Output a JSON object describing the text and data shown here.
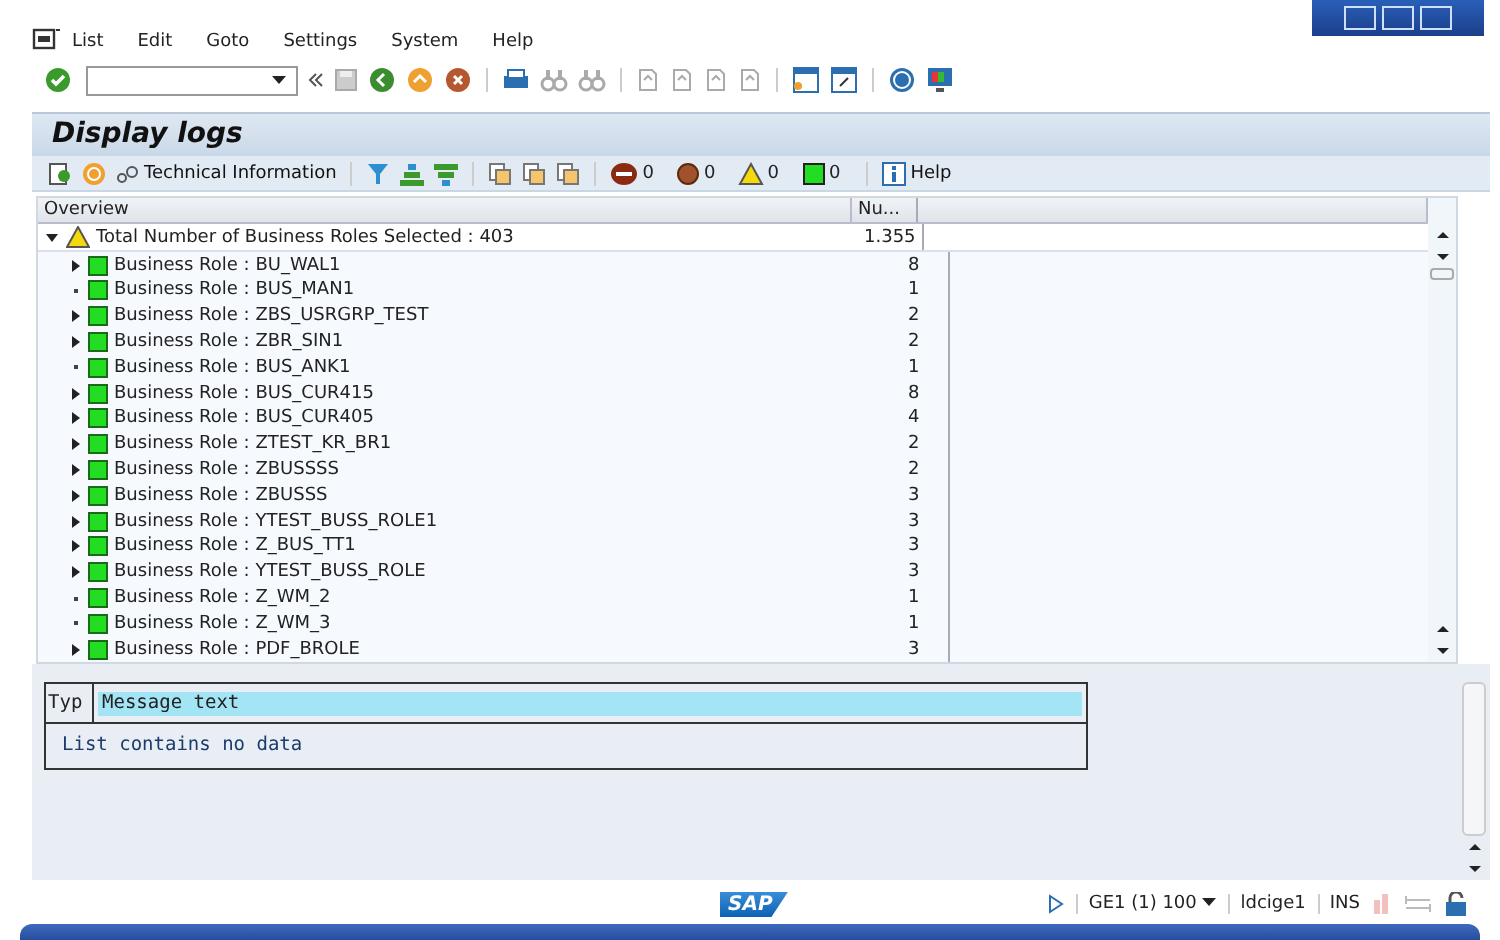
{
  "menu": [
    {
      "label": "List"
    },
    {
      "label": "Edit"
    },
    {
      "label": "Goto"
    },
    {
      "label": "Settings"
    },
    {
      "label": "System"
    },
    {
      "label": "Help"
    }
  ],
  "title": "Display logs",
  "app_toolbar": {
    "technical_info": "Technical Information",
    "counters": [
      {
        "kind": "stop",
        "count": "0"
      },
      {
        "kind": "error",
        "count": "0"
      },
      {
        "kind": "warning",
        "count": "0"
      },
      {
        "kind": "success",
        "count": "0"
      }
    ],
    "help": "Help"
  },
  "tree": {
    "columns": [
      "Overview",
      "Nu..."
    ],
    "root": {
      "label": "Total Number of Business Roles Selected : 403",
      "count": "1.355",
      "expanded": true,
      "children": [
        {
          "kind": "branch",
          "label": "Business Role : BU_WAL1",
          "count": "8"
        },
        {
          "kind": "leaf",
          "label": "Business Role : BUS_MAN1",
          "count": "1"
        },
        {
          "kind": "branch",
          "label": "Business Role : ZBS_USRGRP_TEST",
          "count": "2"
        },
        {
          "kind": "branch",
          "label": "Business Role : ZBR_SIN1",
          "count": "2"
        },
        {
          "kind": "leaf",
          "label": "Business Role : BUS_ANK1",
          "count": "1"
        },
        {
          "kind": "branch",
          "label": "Business Role : BUS_CUR415",
          "count": "8"
        },
        {
          "kind": "branch",
          "label": "Business Role : BUS_CUR405",
          "count": "4"
        },
        {
          "kind": "branch",
          "label": "Business Role : ZTEST_KR_BR1",
          "count": "2"
        },
        {
          "kind": "branch",
          "label": "Business Role : ZBUSSSS",
          "count": "2"
        },
        {
          "kind": "branch",
          "label": "Business Role : ZBUSSS",
          "count": "3"
        },
        {
          "kind": "branch",
          "label": "Business Role : YTEST_BUSS_ROLE1",
          "count": "3"
        },
        {
          "kind": "branch",
          "label": "Business Role : Z_BUS_TT1",
          "count": "3"
        },
        {
          "kind": "branch",
          "label": "Business Role : YTEST_BUSS_ROLE",
          "count": "3"
        },
        {
          "kind": "leaf",
          "label": "Business Role : Z_WM_2",
          "count": "1"
        },
        {
          "kind": "leaf",
          "label": "Business Role : Z_WM_3",
          "count": "1"
        },
        {
          "kind": "branch",
          "label": "Business Role : PDF_BROLE",
          "count": "3"
        }
      ]
    }
  },
  "messages": {
    "columns": [
      "Typ",
      "Message text"
    ],
    "empty_text": "List contains no data"
  },
  "status_bar": {
    "logo": "SAP",
    "system": "GE1 (1) 100",
    "server": "ldcige1",
    "mode": "INS"
  }
}
